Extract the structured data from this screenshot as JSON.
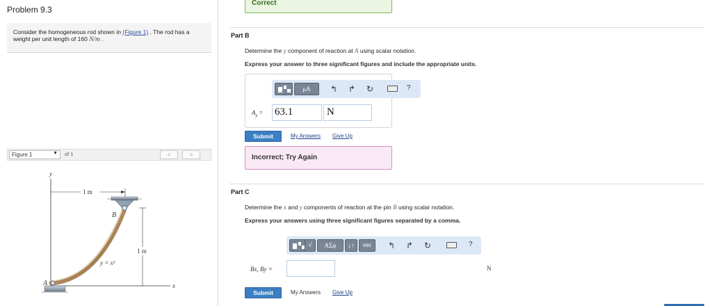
{
  "problem": {
    "title": "Problem 9.3"
  },
  "intro": {
    "text_before_link": "Consider the homogeneous rod shown in ",
    "link": "(Figure 1)",
    "text_after_link": " . The rod has a weight per unit length of 160 ",
    "unit": "N/m",
    "end": " ."
  },
  "figure": {
    "select_value": "Figure 1",
    "of_text": "of 1",
    "prev": "<",
    "next": ">",
    "labels": {
      "y": "y",
      "x": "x",
      "A": "A",
      "B": "B",
      "width": "1 m",
      "height": "1 m",
      "curve": "y = x²"
    }
  },
  "partA": {
    "correct_label": "Correct"
  },
  "partB": {
    "label": "Part B",
    "prompt_1": "Determine the ",
    "prompt_var": "y",
    "prompt_2": " component of reaction at ",
    "prompt_point": "A",
    "prompt_3": " using scalar notation.",
    "instruction": "Express your answer to three significant figures and include the appropriate units.",
    "toolbar": {
      "mu_label": "μA",
      "help": "?"
    },
    "var_label": "A",
    "var_sub": "y",
    "value": "63.1",
    "unit": "N",
    "submit": "Submit",
    "my_answers": "My Answers",
    "give_up": "Give Up",
    "feedback": "Incorrect; Try Again"
  },
  "partC": {
    "label": "Part C",
    "prompt_1": "Determine the ",
    "prompt_x": "x",
    "prompt_2": " and ",
    "prompt_y": "y",
    "prompt_3": " components of reaction at the pin ",
    "prompt_point": "B",
    "prompt_4": " using scalar notation.",
    "instruction": "Express your answers using three significant figures separated by a comma.",
    "toolbar": {
      "sqrt_label": "√",
      "greek_label": "ΑΣφ",
      "arrows_label": "↓↑",
      "vec_label": "vec",
      "help": "?"
    },
    "var_label": "Bx, By =",
    "unit": "N",
    "submit": "Submit",
    "my_answers": "My Answers",
    "give_up": "Give Up"
  }
}
